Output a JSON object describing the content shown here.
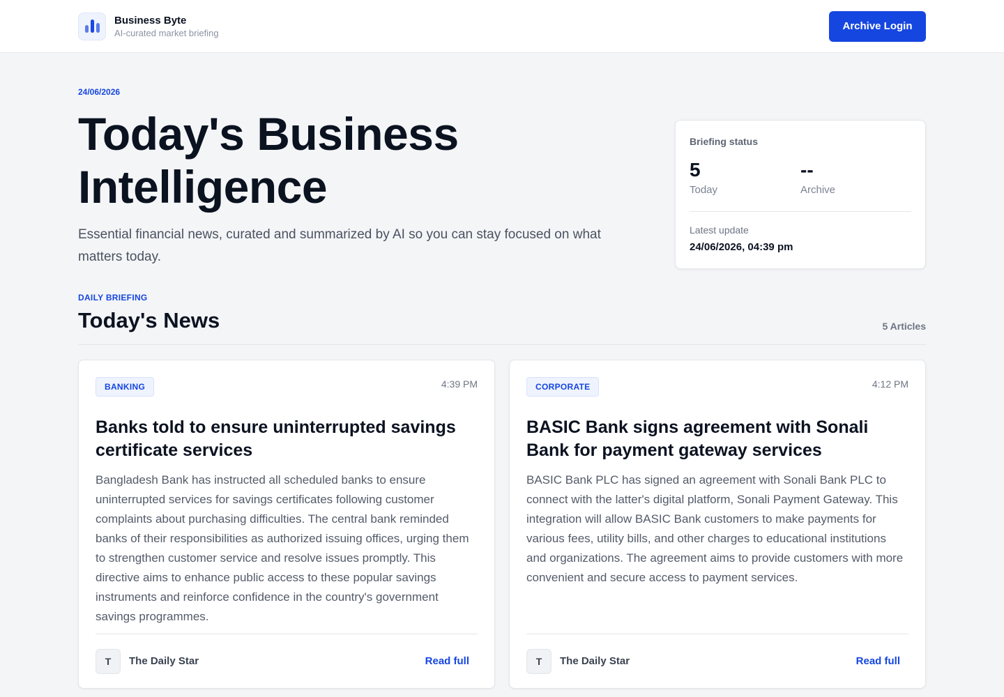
{
  "header": {
    "brand_name": "Business Byte",
    "brand_tagline": "AI-curated market briefing",
    "login_label": "Archive Login"
  },
  "hero": {
    "date": "24/06/2026",
    "title": "Today's Business Intelligence",
    "subtitle": "Essential financial news, curated and summarized by AI so you can stay focused on what matters today."
  },
  "status": {
    "label": "Briefing status",
    "today_value": "5",
    "today_label": "Today",
    "archive_value": "--",
    "archive_label": "Archive",
    "latest_label": "Latest update",
    "latest_value": "24/06/2026, 04:39 pm"
  },
  "news_section": {
    "eyebrow": "DAILY BRIEFING",
    "title": "Today's News",
    "count": "5 Articles"
  },
  "articles": [
    {
      "category": "BANKING",
      "time": "4:39 PM",
      "title": "Banks told to ensure uninterrupted savings certificate services",
      "summary": "Bangladesh Bank has instructed all scheduled banks to ensure uninterrupted services for savings certificates following customer complaints about purchasing difficulties. The central bank reminded banks of their responsibilities as authorized issuing offices, urging them to strengthen customer service and resolve issues promptly. This directive aims to enhance public access to these popular savings instruments and reinforce confidence in the country's government savings programmes.",
      "source_initial": "T",
      "source": "The Daily Star",
      "read_label": "Read full"
    },
    {
      "category": "CORPORATE",
      "time": "4:12 PM",
      "title": "BASIC Bank signs agreement with Sonali Bank for payment gateway services",
      "summary": "BASIC Bank PLC has signed an agreement with Sonali Bank PLC to connect with the latter's digital platform, Sonali Payment Gateway. This integration will allow BASIC Bank customers to make payments for various fees, utility bills, and other charges to educational institutions and organizations. The agreement aims to provide customers with more convenient and secure access to payment services.",
      "source_initial": "T",
      "source": "The Daily Star",
      "read_label": "Read full"
    }
  ]
}
